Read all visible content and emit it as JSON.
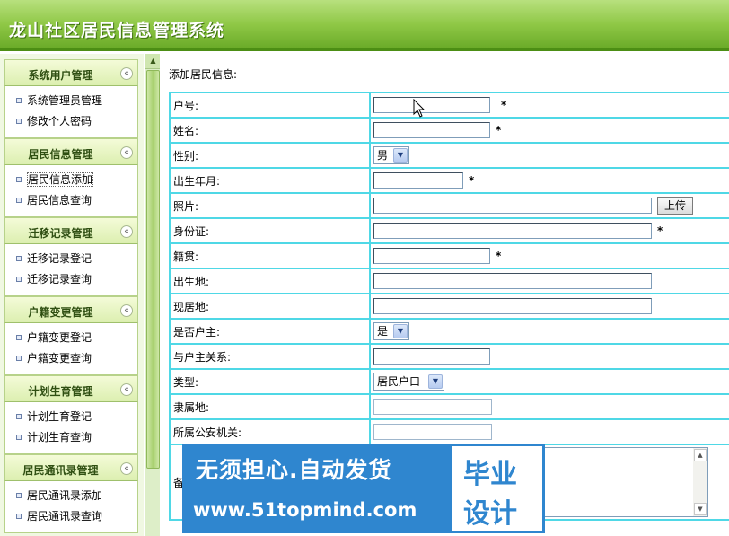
{
  "header": {
    "title": "龙山社区居民信息管理系统"
  },
  "sidebar": {
    "groups": [
      {
        "title": "系统用户管理",
        "items": [
          {
            "label": "系统管理员管理"
          },
          {
            "label": "修改个人密码"
          }
        ]
      },
      {
        "title": "居民信息管理",
        "items": [
          {
            "label": "居民信息添加"
          },
          {
            "label": "居民信息查询"
          }
        ]
      },
      {
        "title": "迁移记录管理",
        "items": [
          {
            "label": "迁移记录登记"
          },
          {
            "label": "迁移记录查询"
          }
        ]
      },
      {
        "title": "户籍变更管理",
        "items": [
          {
            "label": "户籍变更登记"
          },
          {
            "label": "户籍变更查询"
          }
        ]
      },
      {
        "title": "计划生育管理",
        "items": [
          {
            "label": "计划生育登记"
          },
          {
            "label": "计划生育查询"
          }
        ]
      },
      {
        "title": "居民通讯录管理",
        "items": [
          {
            "label": "居民通讯录添加"
          },
          {
            "label": "居民通讯录查询"
          }
        ]
      }
    ],
    "toggle_glyph": "«",
    "active_item": "居民信息添加"
  },
  "main": {
    "section_title": "添加居民信息:",
    "required_mark": "*",
    "fields": [
      {
        "label": "户号:",
        "value": "",
        "type": "text"
      },
      {
        "label": "姓名:",
        "value": "",
        "type": "text"
      },
      {
        "label": "性别:",
        "value": "男",
        "type": "select"
      },
      {
        "label": "出生年月:",
        "value": "",
        "type": "text"
      },
      {
        "label": "照片:",
        "value": "",
        "type": "text",
        "button": "上传"
      },
      {
        "label": "身份证:",
        "value": "",
        "type": "text"
      },
      {
        "label": "籍贯:",
        "value": "",
        "type": "text"
      },
      {
        "label": "出生地:",
        "value": "",
        "type": "text"
      },
      {
        "label": "现居地:",
        "value": "",
        "type": "text"
      },
      {
        "label": "是否户主:",
        "value": "是",
        "type": "select"
      },
      {
        "label": "与户主关系:",
        "value": "",
        "type": "text"
      },
      {
        "label": "类型:",
        "value": "居民户口",
        "type": "select"
      },
      {
        "label": "隶属地:",
        "value": "",
        "type": "text"
      },
      {
        "label": "所属公安机关:",
        "value": "",
        "type": "text"
      },
      {
        "label": "备",
        "value": "",
        "type": "textarea"
      }
    ]
  },
  "watermark": {
    "line1": "无须担心.自动发货",
    "line2": "www.51topmind.com",
    "right1": "毕业",
    "right2": "设计",
    "color": "#2f86cf"
  },
  "colors": {
    "header": "#8fc846",
    "border_cyan": "#4fd8e6",
    "sidebar_bg": "#f0f8e2"
  }
}
